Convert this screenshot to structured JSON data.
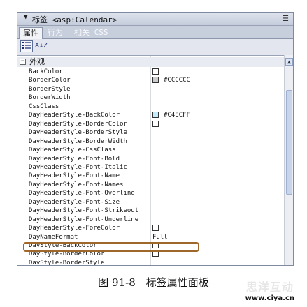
{
  "panel": {
    "title": "标签 <asp:Calendar>",
    "tabs": [
      {
        "label": "属性",
        "active": true
      },
      {
        "label": "行为",
        "active": false
      },
      {
        "label": "相关 CSS",
        "active": false
      }
    ],
    "toolbar": {
      "category_view": "category-view",
      "sort": "A↓Z"
    },
    "category": {
      "toggle": "−",
      "label": "外观"
    },
    "properties": [
      {
        "name": "BackColor",
        "value": "",
        "swatch": "#ffffff"
      },
      {
        "name": "BorderColor",
        "value": "#CCCCCC",
        "swatch": "#cccccc"
      },
      {
        "name": "BorderStyle",
        "value": ""
      },
      {
        "name": "BorderWidth",
        "value": ""
      },
      {
        "name": "CssClass",
        "value": ""
      },
      {
        "name": "DayHeaderStyle-BackColor",
        "value": "#C4ECFF",
        "swatch": "#c4ecff"
      },
      {
        "name": "DayHeaderStyle-BorderColor",
        "value": "",
        "swatch": "#ffffff"
      },
      {
        "name": "DayHeaderStyle-BorderStyle",
        "value": ""
      },
      {
        "name": "DayHeaderStyle-BorderWidth",
        "value": ""
      },
      {
        "name": "DayHeaderStyle-CssClass",
        "value": ""
      },
      {
        "name": "DayHeaderStyle-Font-Bold",
        "value": ""
      },
      {
        "name": "DayHeaderStyle-Font-Italic",
        "value": ""
      },
      {
        "name": "DayHeaderStyle-Font-Name",
        "value": ""
      },
      {
        "name": "DayHeaderStyle-Font-Names",
        "value": ""
      },
      {
        "name": "DayHeaderStyle-Font-Overline",
        "value": ""
      },
      {
        "name": "DayHeaderStyle-Font-Size",
        "value": ""
      },
      {
        "name": "DayHeaderStyle-Font-Strikeout",
        "value": ""
      },
      {
        "name": "DayHeaderStyle-Font-Underline",
        "value": ""
      },
      {
        "name": "DayHeaderStyle-ForeColor",
        "value": "",
        "swatch": "#ffffff"
      },
      {
        "name": "DayNameFormat",
        "value": "Full"
      },
      {
        "name": "DayStyle-BackColor",
        "value": "",
        "swatch": "#ffffff"
      },
      {
        "name": "DayStyle-BorderColor",
        "value": "",
        "swatch": "#ffffff"
      },
      {
        "name": "DayStyle-BorderStyle",
        "value": ""
      }
    ]
  },
  "caption": "图 91-8　标签属性面板",
  "watermark": {
    "text": "思洋互动",
    "url": "www.ciya.cn"
  }
}
